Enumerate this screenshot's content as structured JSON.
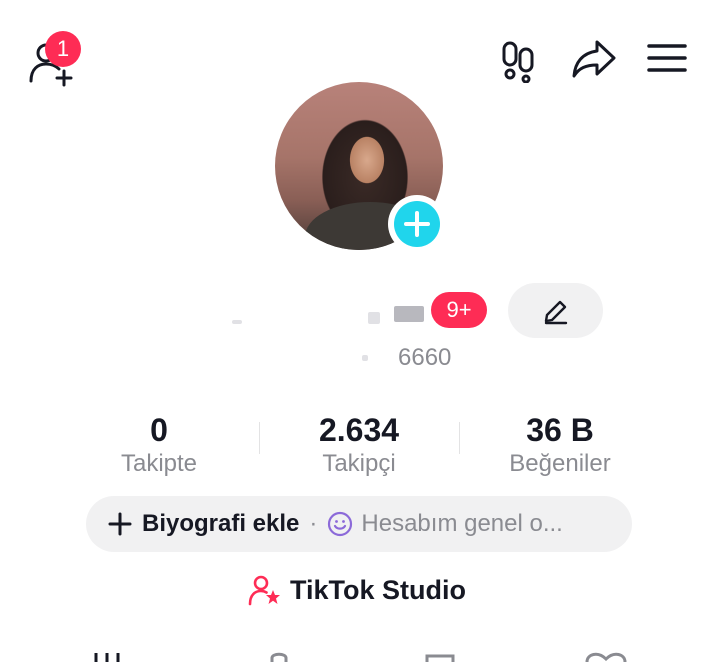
{
  "header": {
    "add_friend_badge": "1",
    "icons": [
      "add-friend-icon",
      "footprints-icon",
      "share-icon",
      "menu-icon"
    ]
  },
  "profile": {
    "username_obscured": "",
    "notification_pill": "9+",
    "handle": "6660"
  },
  "stats": [
    {
      "value": "0",
      "label": "Takipte"
    },
    {
      "value": "2.634",
      "label": "Takipçi"
    },
    {
      "value": "36 B",
      "label": "Beğeniler"
    }
  ],
  "bio": {
    "add_label": "Biyografi ekle",
    "separator": "·",
    "hint": "Hesabım genel o..."
  },
  "studio": {
    "label": "TikTok Studio"
  },
  "colors": {
    "accent": "#fe2c55",
    "plus_badge": "#20d5ec",
    "pill_bg": "#f1f1f2",
    "muted_text": "#8a8b91",
    "emoji_purple": "#8c6ad9"
  }
}
